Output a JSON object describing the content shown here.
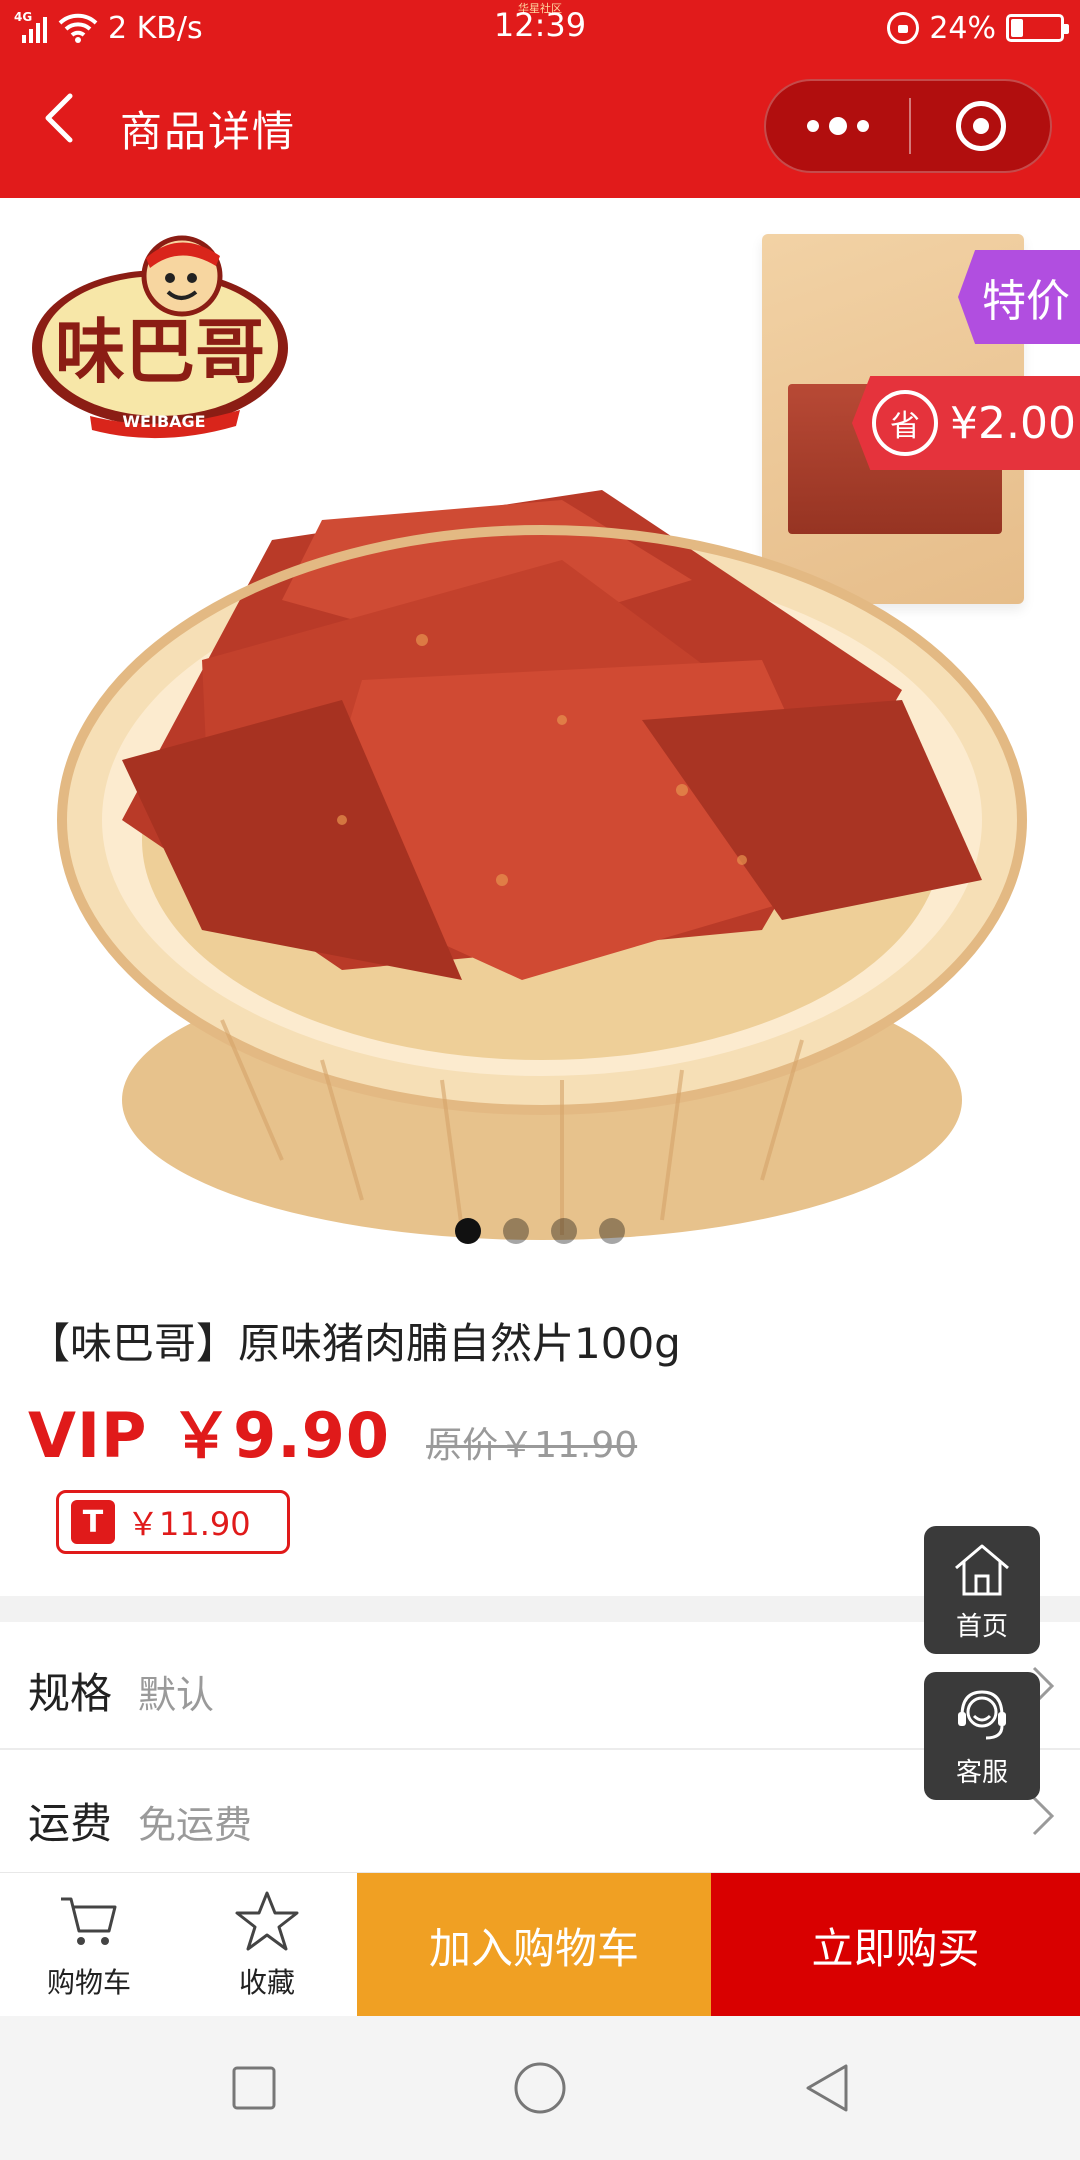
{
  "status_bar": {
    "network": "4G",
    "speed": "2 KB/s",
    "time": "12:39",
    "time_sub": "华星社区",
    "battery": "24%",
    "battery_level": 0.24
  },
  "nav": {
    "title": "商品详情",
    "back_icon": "chevron-left-icon",
    "more_icon": "more-dots-icon",
    "close_icon": "target-circle-icon"
  },
  "gallery": {
    "brand_logo_text": "味巴哥",
    "brand_logo_sub": "WEIBAGE",
    "special_tag": "特价",
    "save_icon_text": "省",
    "save_amount": "¥2.00",
    "slides": 4,
    "active_slide": 1
  },
  "product": {
    "title": "【味巴哥】原味猪肉脯自然片100g",
    "vip_price": "VIP ￥9.90",
    "original_price": "原价￥11.90",
    "t_price": "￥11.90"
  },
  "options": {
    "spec_label": "规格",
    "spec_value": "默认",
    "shipping_label": "运费",
    "shipping_value": "免运费"
  },
  "floating": {
    "home_label": "首页",
    "service_label": "客服"
  },
  "action_bar": {
    "cart_label": "购物车",
    "fav_label": "收藏",
    "add_to_cart": "加入购物车",
    "buy_now": "立即购买"
  },
  "colors": {
    "brand_red": "#e11b1b",
    "buy_red": "#d90000",
    "add_orange": "#f0a023",
    "special_purple": "#b14ee0"
  }
}
